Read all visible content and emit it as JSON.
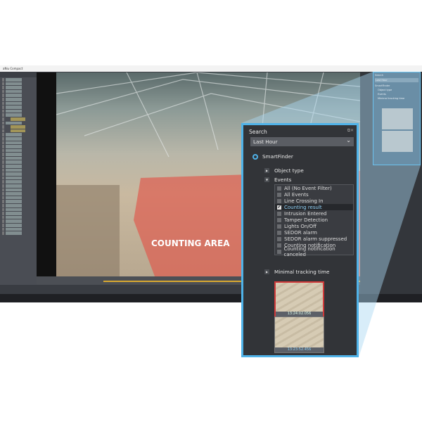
{
  "window": {
    "title": "aNiu Compact"
  },
  "video": {
    "overlay_label": "COUNTING AREA"
  },
  "search": {
    "title": "Search",
    "time_range": "Last Hour",
    "smartfinder_label": "SmartFinder",
    "object_type_label": "Object type",
    "events_label": "Events",
    "events": [
      {
        "label": "All (No Event Filter)",
        "checked": false
      },
      {
        "label": "All Events",
        "checked": false
      },
      {
        "label": "Line Crossing In",
        "checked": false
      },
      {
        "label": "Counting result",
        "checked": true
      },
      {
        "label": "Intrusion Entered",
        "checked": false
      },
      {
        "label": "Tamper Detection",
        "checked": false
      },
      {
        "label": "Lights On/Off",
        "checked": false
      },
      {
        "label": "SEDOR alarm",
        "checked": false
      },
      {
        "label": "SEDOR alarm suppressed",
        "checked": false
      },
      {
        "label": "Counting notification",
        "checked": false
      },
      {
        "label": "Counting notification canceled",
        "checked": false
      }
    ],
    "minimal_tracking_label": "Minimal tracking time",
    "results": [
      {
        "timestamp": "13:24:02.056",
        "selected": true
      },
      {
        "timestamp": "13:23:52.456",
        "selected": false
      }
    ]
  },
  "mini_panel": {
    "title": "Search",
    "time_range": "Last Hour",
    "smartfinder_label": "SmartFinder",
    "items": [
      "Object type",
      "Events",
      "Minimal tracking time"
    ]
  },
  "colors": {
    "accent": "#4fb2e8",
    "counting_area": "#e0564a",
    "timeline": "#d8a830"
  }
}
